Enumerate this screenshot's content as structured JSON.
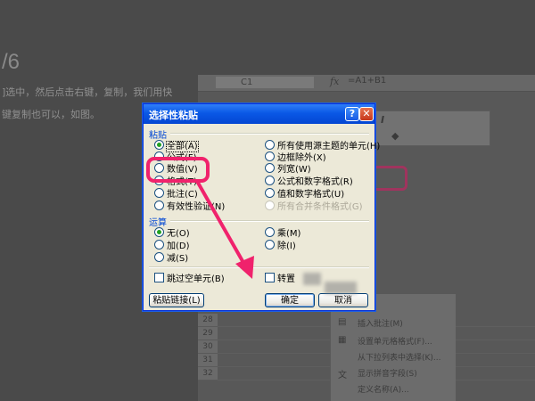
{
  "article": {
    "step": "/6",
    "line1": "]选中，然后点击右键，复制，我们用快",
    "line2": "键复制也可以，如图。"
  },
  "sheet": {
    "cell_ref": "C1",
    "fx": "fx",
    "formula": "=A1+B1",
    "row_numbers": [
      "28",
      "29",
      "30",
      "31",
      "32"
    ],
    "context_menu": [
      "插入批注(M)",
      "设置单元格格式(F)...",
      "从下拉列表中选择(K)...",
      "显示拼音字段(S)",
      "定义名称(A)..."
    ]
  },
  "dialog": {
    "title": "选择性粘贴",
    "help_label": "?",
    "close_label": "✕",
    "paste_group": "粘贴",
    "paste_left": [
      "全部(A)",
      "公式(F)",
      "数值(V)",
      "格式(T)",
      "批注(C)",
      "有效性验证(N)"
    ],
    "paste_right": [
      "所有使用源主题的单元(H)",
      "边框除外(X)",
      "列宽(W)",
      "公式和数字格式(R)",
      "值和数字格式(U)",
      "所有合并条件格式(G)"
    ],
    "operation_group": "运算",
    "op_left": [
      "无(O)",
      "加(D)",
      "减(S)"
    ],
    "op_right": [
      "乘(M)",
      "除(I)"
    ],
    "skip_blanks": "跳过空单元(B)",
    "transpose": "转置",
    "paste_link_btn": "粘贴链接(L)",
    "ok_btn": "确定",
    "cancel_btn": "取消"
  },
  "colors": {
    "highlight": "#f0226c",
    "title_blue": "#0a58e6",
    "group_label": "#0046d5"
  }
}
